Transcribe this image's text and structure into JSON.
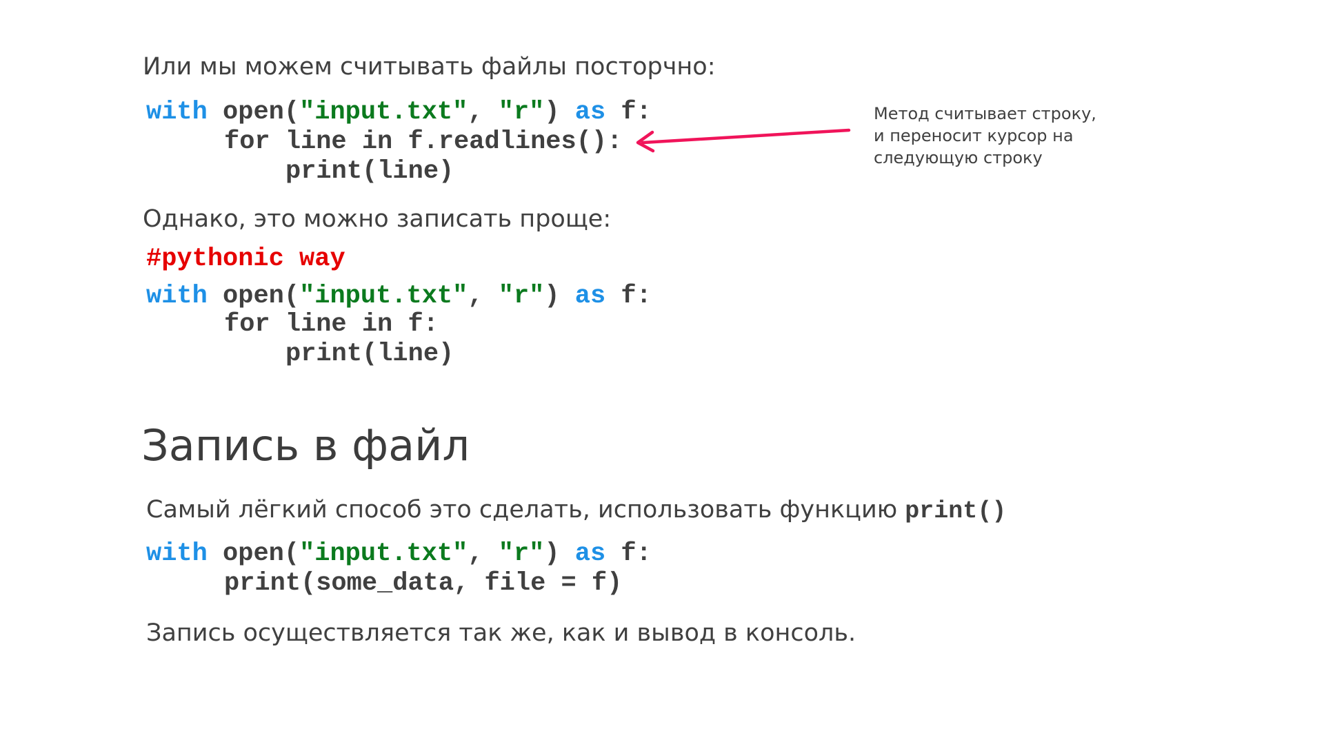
{
  "intro": {
    "line_by_line": "Или мы можем считывать файлы посторчно:",
    "simpler": "Однако, это можно записать проще:"
  },
  "code1": {
    "l1": {
      "with": "with",
      "open": " open(",
      "s1": "\"input.txt\"",
      "comma": ", ",
      "s2": "\"r\"",
      "close": ") ",
      "as": "as",
      "f": " f:"
    },
    "l2": {
      "text": "for line in f.readlines():"
    },
    "l3": {
      "text": "print(line)"
    }
  },
  "annotation": {
    "line1": "Метод считывает строку,",
    "line2": "и переносит курсор на",
    "line3": "следующую строку",
    "arrow_color": "#f0145a"
  },
  "comment": "#pythonic way",
  "code2": {
    "l1": {
      "with": "with",
      "open": " open(",
      "s1": "\"input.txt\"",
      "comma": ", ",
      "s2": "\"r\"",
      "close": ") ",
      "as": "as",
      "f": " f:"
    },
    "l2": {
      "text": "for line in f:"
    },
    "l3": {
      "text": "print(line)"
    }
  },
  "section": {
    "title": "Запись в файл",
    "desc_text": "Самый лёгкий способ это сделать, использовать функцию ",
    "desc_code": "print()"
  },
  "code3": {
    "l1": {
      "with": "with",
      "open": " open(",
      "s1": "\"input.txt\"",
      "comma": ", ",
      "s2": "\"r\"",
      "close": ") ",
      "as": "as",
      "f": " f:"
    },
    "l2": {
      "text": "print(some_data, file = f)"
    }
  },
  "footer": {
    "text": "Запись осуществляется так же, как и вывод в консоль."
  },
  "colors": {
    "keyword": "#1e90e6",
    "string": "#0b7a1e",
    "comment": "#e60000",
    "text": "#404040"
  }
}
